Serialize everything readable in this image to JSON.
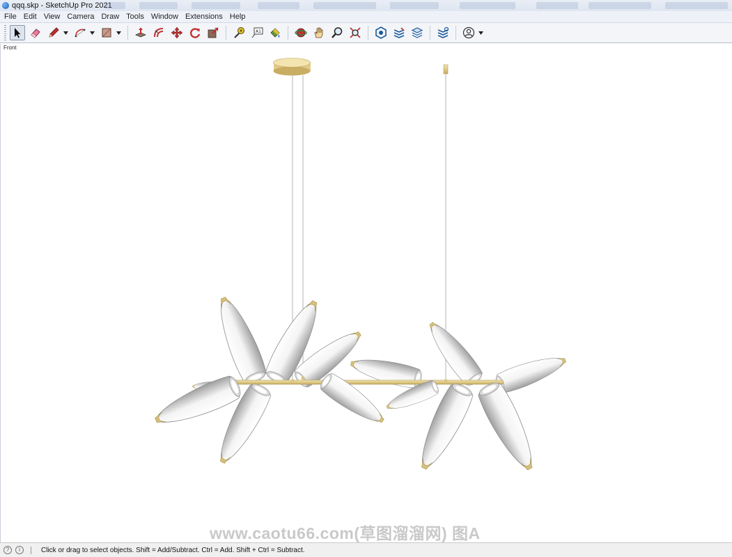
{
  "window": {
    "title": "qqq.skp - SketchUp Pro 2021"
  },
  "menu": [
    "File",
    "Edit",
    "View",
    "Camera",
    "Draw",
    "Tools",
    "Window",
    "Extensions",
    "Help"
  ],
  "toolbar": {
    "tools": [
      {
        "name": "select-tool",
        "icon": "cursor-arrow-icon",
        "active": true
      },
      {
        "name": "eraser-tool",
        "icon": "eraser-icon"
      },
      {
        "name": "pencil-tool",
        "icon": "pencil-icon",
        "dropdown": true
      },
      {
        "name": "arc-tool",
        "icon": "arc-icon",
        "dropdown": true
      },
      {
        "name": "rectangle-tool",
        "icon": "rectangle-icon",
        "dropdown": true
      },
      {
        "name": "push-pull-tool",
        "icon": "push-pull-icon"
      },
      {
        "name": "offset-tool",
        "icon": "offset-icon"
      },
      {
        "name": "move-tool",
        "icon": "move-icon"
      },
      {
        "name": "rotate-tool",
        "icon": "rotate-icon"
      },
      {
        "name": "scale-tool",
        "icon": "scale-icon"
      },
      {
        "name": "tape-measure-tool",
        "icon": "tape-measure-icon"
      },
      {
        "name": "text-tool",
        "icon": "text-icon"
      },
      {
        "name": "paint-bucket-tool",
        "icon": "paint-bucket-icon"
      },
      {
        "name": "orbit-tool",
        "icon": "orbit-icon"
      },
      {
        "name": "pan-tool",
        "icon": "hand-icon"
      },
      {
        "name": "zoom-tool",
        "icon": "magnifier-icon"
      },
      {
        "name": "zoom-extents-tool",
        "icon": "zoom-extents-icon"
      },
      {
        "name": "3d-warehouse-tool",
        "icon": "warehouse-icon"
      },
      {
        "name": "extension-warehouse-tool",
        "icon": "extension-warehouse-icon"
      },
      {
        "name": "layout-tool",
        "icon": "layers-icon"
      },
      {
        "name": "extension-manager-tool",
        "icon": "extension-manager-icon"
      },
      {
        "name": "account-tool",
        "icon": "user-account-icon",
        "dropdown": true
      }
    ]
  },
  "viewport": {
    "scene_label": "Front",
    "watermark": "www.caotu66.com(草图溜溜网) 图A"
  },
  "statusbar": {
    "message": "Click or drag to select objects. Shift = Add/Subtract. Ctrl = Add. Shift + Ctrl = Subtract."
  },
  "colors": {
    "brass": "#d9c483",
    "glass_light": "#ffffff",
    "glass_dark": "#9e9e9e",
    "toolbar_bg": "#f3f5f9"
  }
}
